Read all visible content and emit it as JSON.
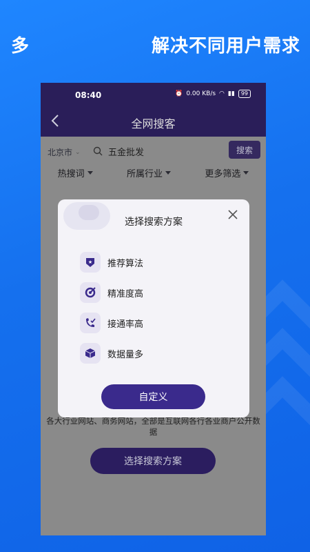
{
  "promo": {
    "left_text": "多",
    "right_text": "解决不同用户需求"
  },
  "status_bar": {
    "time": "08:40",
    "net_speed": "0.00 KB/s",
    "battery": "99"
  },
  "navbar": {
    "title": "全网搜客"
  },
  "search": {
    "city": "北京市",
    "value": "五金批发",
    "button_label": "搜索"
  },
  "filters": [
    {
      "label": "热搜词"
    },
    {
      "label": "所属行业"
    },
    {
      "label": "更多筛选"
    }
  ],
  "description": "各大行业网站、商务网站，全部是互联网各行各业商户公开数据",
  "bottom_button": "选择搜索方案",
  "modal": {
    "title": "选择搜索方案",
    "options": [
      {
        "label": "推荐算法",
        "icon": "shield-star-icon"
      },
      {
        "label": "精准度高",
        "icon": "target-icon"
      },
      {
        "label": "接通率高",
        "icon": "phone-check-icon"
      },
      {
        "label": "数据量多",
        "icon": "cube-icon"
      }
    ],
    "custom_button": "自定义"
  },
  "colors": {
    "background": "#1570ee",
    "header": "#2a1e59",
    "accent": "#3a2a8c",
    "overlay": "#8a8a8a"
  }
}
